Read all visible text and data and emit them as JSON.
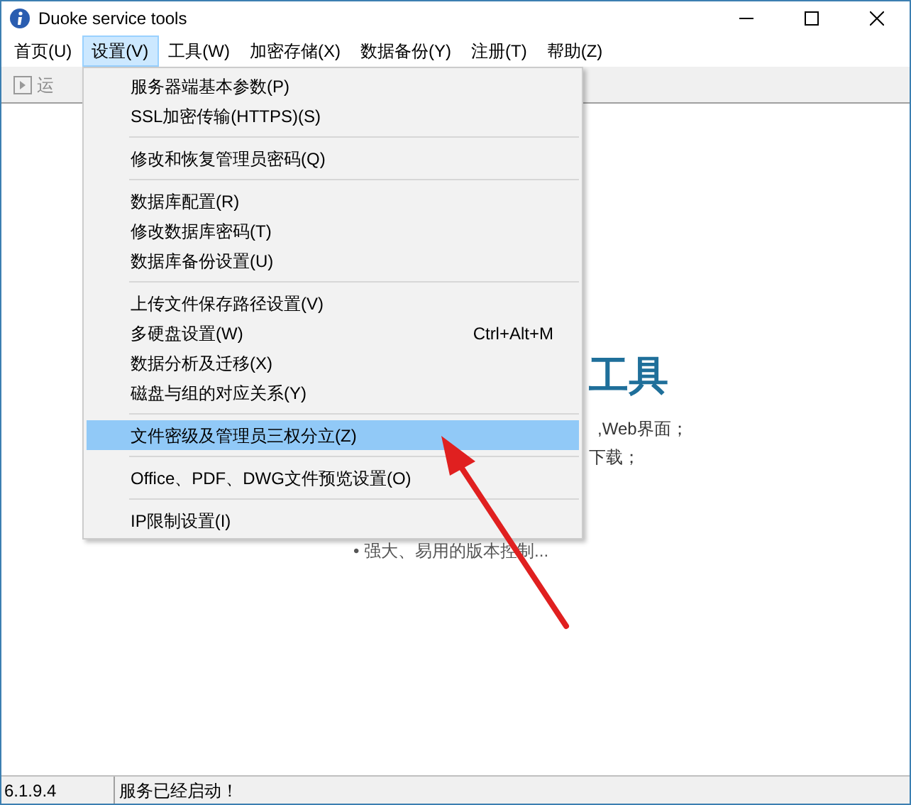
{
  "window": {
    "title": "Duoke service tools"
  },
  "menubar": [
    {
      "label": "首页(U)",
      "selected": false
    },
    {
      "label": "设置(V)",
      "selected": true
    },
    {
      "label": "工具(W)",
      "selected": false
    },
    {
      "label": "加密存储(X)",
      "selected": false
    },
    {
      "label": "数据备份(Y)",
      "selected": false
    },
    {
      "label": "注册(T)",
      "selected": false
    },
    {
      "label": "帮助(Z)",
      "selected": false
    }
  ],
  "toolbar": {
    "run_button": "运"
  },
  "menu": [
    {
      "kind": "item",
      "label": "服务器端基本参数(P)",
      "selected": false
    },
    {
      "kind": "item",
      "label": "SSL加密传输(HTTPS)(S)",
      "selected": false
    },
    {
      "kind": "separator"
    },
    {
      "kind": "item",
      "label": "修改和恢复管理员密码(Q)",
      "selected": false
    },
    {
      "kind": "separator"
    },
    {
      "kind": "item",
      "label": "数据库配置(R)",
      "selected": false
    },
    {
      "kind": "item",
      "label": "修改数据库密码(T)",
      "selected": false
    },
    {
      "kind": "item",
      "label": "数据库备份设置(U)",
      "selected": false
    },
    {
      "kind": "separator"
    },
    {
      "kind": "item",
      "label": "上传文件保存路径设置(V)",
      "selected": false
    },
    {
      "kind": "item",
      "label": "多硬盘设置(W)",
      "shortcut": "Ctrl+Alt+M",
      "selected": false
    },
    {
      "kind": "item",
      "label": "数据分析及迁移(X)",
      "selected": false
    },
    {
      "kind": "item",
      "label": "磁盘与组的对应关系(Y)",
      "selected": false
    },
    {
      "kind": "separator"
    },
    {
      "kind": "item",
      "label": "文件密级及管理员三权分立(Z)",
      "selected": true
    },
    {
      "kind": "separator"
    },
    {
      "kind": "item",
      "label": "Office、PDF、DWG文件预览设置(O)",
      "selected": false
    },
    {
      "kind": "separator"
    },
    {
      "kind": "item",
      "label": "IP限制设置(I)",
      "selected": false
    }
  ],
  "content": {
    "heading": "工具",
    "line_1": ",Web界面；",
    "line_2": "下载；",
    "line_3": "• 强大、易用的版本控制..."
  },
  "status_bar": {
    "version": "6.1.9.4",
    "message": "服务已经启动！"
  }
}
